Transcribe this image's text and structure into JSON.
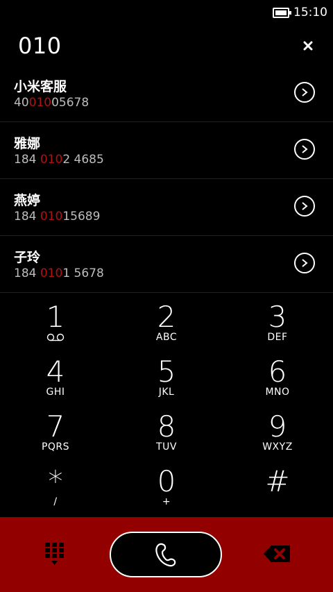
{
  "status": {
    "time": "15:10"
  },
  "dialer": {
    "number": "010"
  },
  "contacts": [
    {
      "name": "小米客服",
      "num_pre": "40",
      "num_match": "010",
      "num_post": "05678"
    },
    {
      "name": "雅娜",
      "num_pre": "184 ",
      "num_match": "010",
      "num_post": "2 4685"
    },
    {
      "name": "燕婷",
      "num_pre": "184 ",
      "num_match": "010",
      "num_post": "15689"
    },
    {
      "name": "子玲",
      "num_pre": "184 ",
      "num_match": "010",
      "num_post": "1 5678"
    }
  ],
  "keys": [
    {
      "digit": "1",
      "letters": ""
    },
    {
      "digit": "2",
      "letters": "ABC"
    },
    {
      "digit": "3",
      "letters": "DEF"
    },
    {
      "digit": "4",
      "letters": "GHI"
    },
    {
      "digit": "5",
      "letters": "JKL"
    },
    {
      "digit": "6",
      "letters": "MNO"
    },
    {
      "digit": "7",
      "letters": "PQRS"
    },
    {
      "digit": "8",
      "letters": "TUV"
    },
    {
      "digit": "9",
      "letters": "WXYZ"
    },
    {
      "digit": "*",
      "letters": "/"
    },
    {
      "digit": "0",
      "letters": "+"
    },
    {
      "digit": "#",
      "letters": ""
    }
  ],
  "colors": {
    "accent": "#920000",
    "highlight": "#b40f0f",
    "background": "#000000"
  },
  "icons": {
    "battery": "battery-icon",
    "clear": "close-icon",
    "contact_action": "chevron-right-circle-icon",
    "voicemail": "voicemail-icon",
    "keypad_toggle": "dialpad-icon",
    "call": "phone-icon",
    "backspace": "backspace-icon"
  }
}
